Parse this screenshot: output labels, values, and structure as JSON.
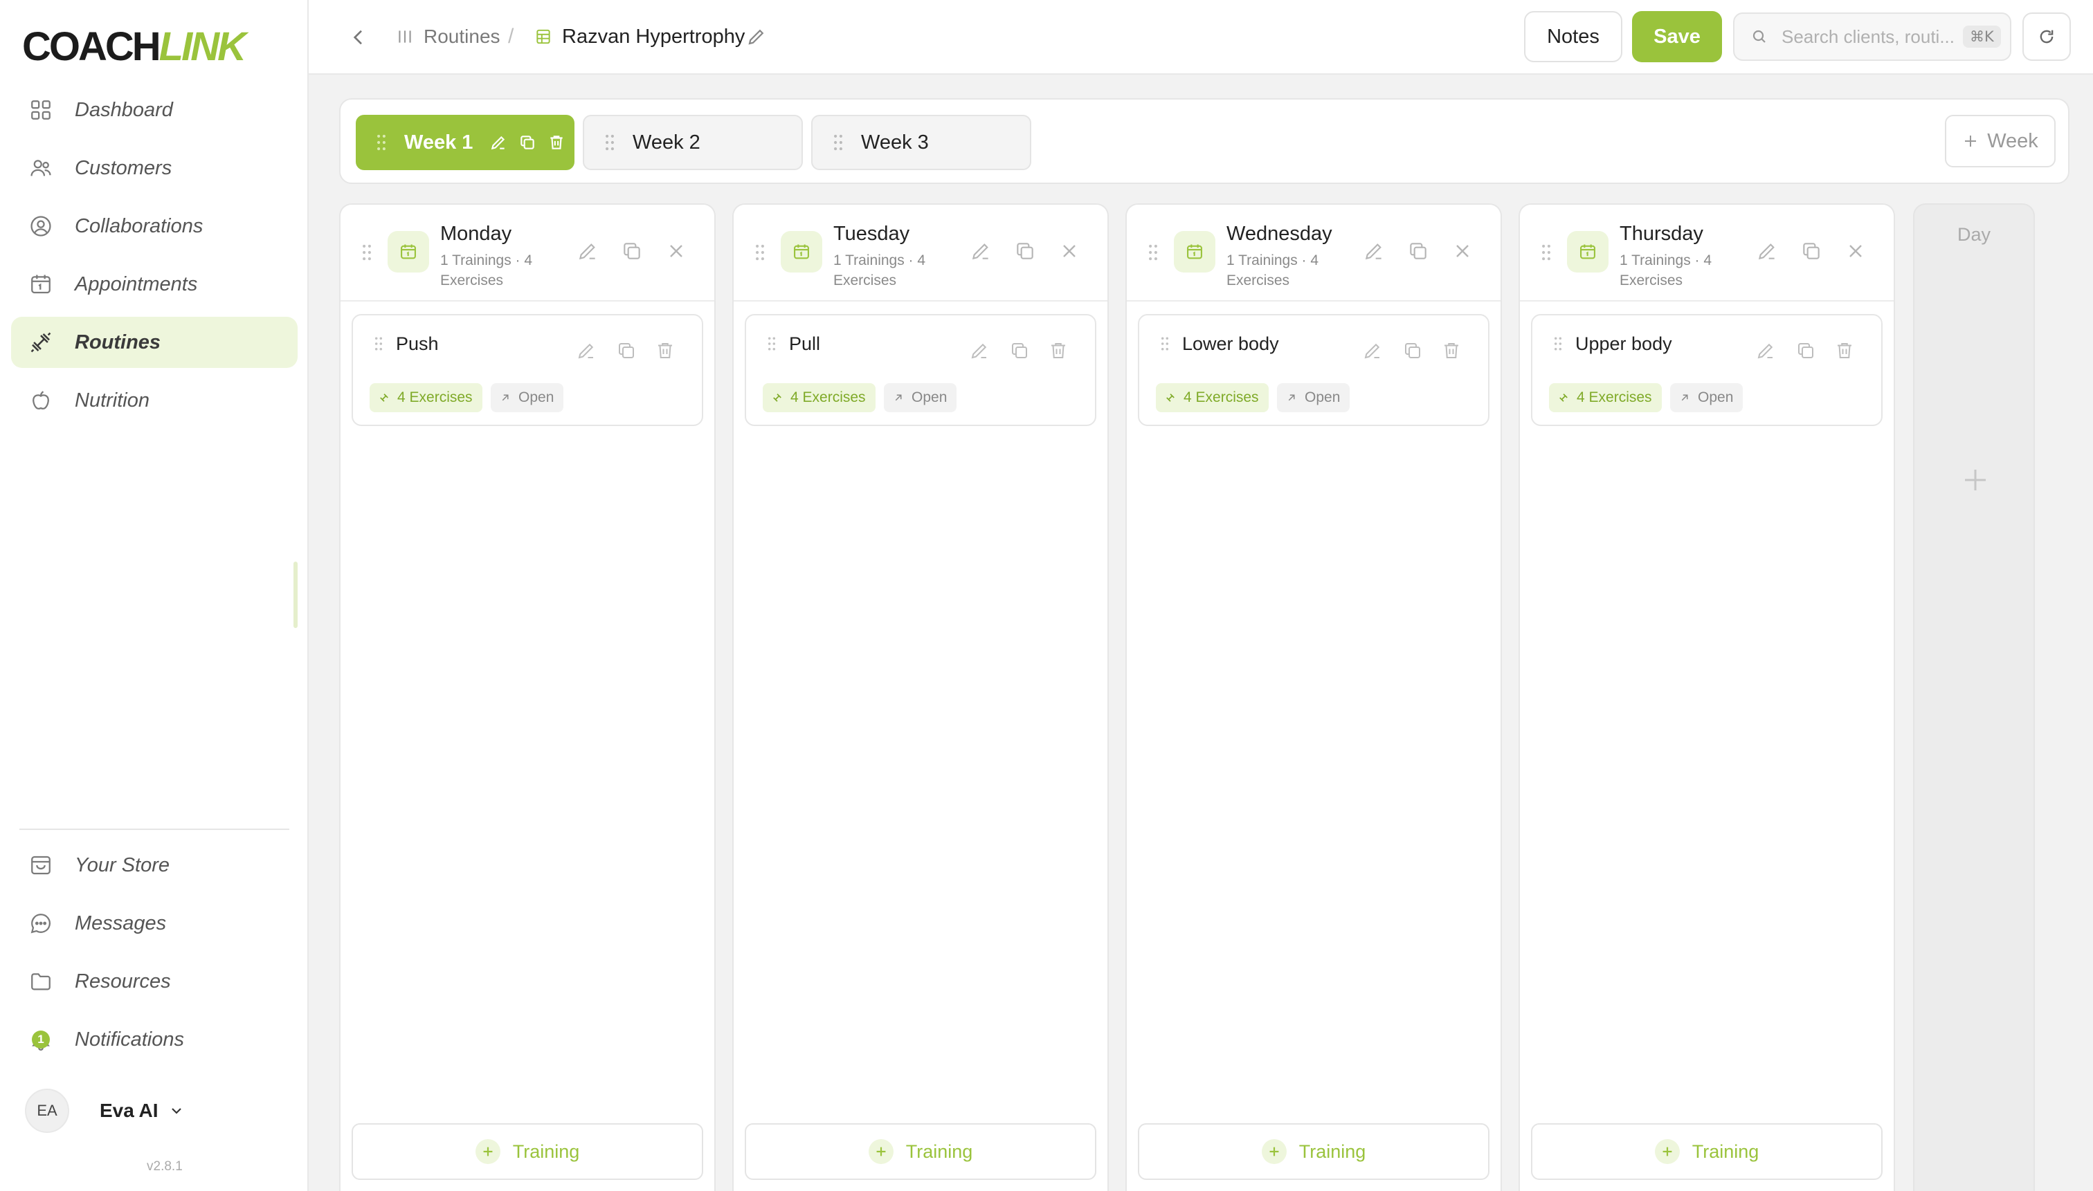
{
  "app": {
    "logo_part1": "COACH",
    "logo_part2": "LINK",
    "version": "v2.8.1"
  },
  "sidebar": {
    "nav": [
      {
        "label": "Dashboard",
        "icon": "dashboard-icon"
      },
      {
        "label": "Customers",
        "icon": "users-icon"
      },
      {
        "label": "Collaborations",
        "icon": "user-circle-icon"
      },
      {
        "label": "Appointments",
        "icon": "calendar-icon"
      },
      {
        "label": "Routines",
        "icon": "dumbbell-icon",
        "active": true
      },
      {
        "label": "Nutrition",
        "icon": "apple-icon"
      }
    ],
    "bottom": [
      {
        "label": "Your Store",
        "icon": "store-icon"
      },
      {
        "label": "Messages",
        "icon": "chat-icon"
      },
      {
        "label": "Resources",
        "icon": "folder-icon"
      },
      {
        "label": "Notifications",
        "icon": "bell-icon",
        "badge": "1"
      }
    ],
    "user": {
      "initials": "EA",
      "name": "Eva AI"
    }
  },
  "header": {
    "breadcrumb_root": "Routines",
    "breadcrumb_sep": "/",
    "breadcrumb_current": "Razvan Hypertrophy",
    "notes_label": "Notes",
    "save_label": "Save",
    "search_placeholder": "Search clients, routi...",
    "search_shortcut": "⌘K"
  },
  "weeks": {
    "tabs": [
      {
        "label": "Week 1",
        "active": true
      },
      {
        "label": "Week 2",
        "active": false
      },
      {
        "label": "Week 3",
        "active": false
      }
    ],
    "add_label": "Week"
  },
  "days": [
    {
      "name": "Monday",
      "meta": "1 Trainings · 4 Exercises",
      "training": {
        "title": "Push",
        "exercises": "4 Exercises",
        "open": "Open"
      },
      "add_label": "Training"
    },
    {
      "name": "Tuesday",
      "meta": "1 Trainings · 4 Exercises",
      "training": {
        "title": "Pull",
        "exercises": "4 Exercises",
        "open": "Open"
      },
      "add_label": "Training"
    },
    {
      "name": "Wednesday",
      "meta": "1 Trainings · 4 Exercises",
      "training": {
        "title": "Lower body",
        "exercises": "4 Exercises",
        "open": "Open"
      },
      "add_label": "Training"
    },
    {
      "name": "Thursday",
      "meta": "1 Trainings · 4 Exercises",
      "training": {
        "title": "Upper body",
        "exercises": "4 Exercises",
        "open": "Open"
      },
      "add_label": "Training"
    }
  ],
  "add_day_label": "Day",
  "colors": {
    "accent": "#9ac33c",
    "accent_light": "#eef6dc"
  }
}
